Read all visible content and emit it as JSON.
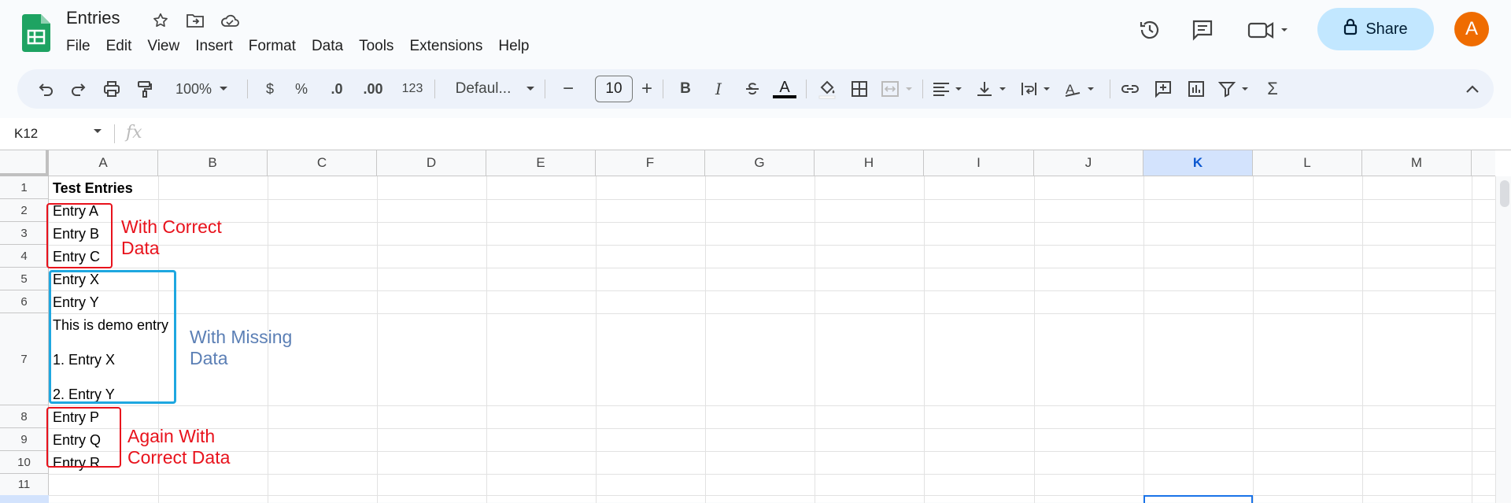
{
  "app": {
    "title": "Entries",
    "menu": [
      "File",
      "Edit",
      "View",
      "Insert",
      "Format",
      "Data",
      "Tools",
      "Extensions",
      "Help"
    ],
    "share_label": "Share",
    "avatar_letter": "A",
    "accent": "#0b57d0",
    "share_bg": "#c2e7ff",
    "avatar_bg": "#ef6c00"
  },
  "toolbar": {
    "zoom": "100%",
    "currency": "$",
    "percent": "%",
    "dec_decrease": ".0",
    "dec_increase": ".00",
    "number_format": "123",
    "font": "Defaul...",
    "font_size": "10",
    "minus": "−",
    "plus": "+",
    "bold": "B",
    "italic": "I",
    "text_color": "A",
    "sum": "Σ"
  },
  "formula_bar": {
    "cell_ref": "K12",
    "fx": "fx"
  },
  "grid": {
    "columns": [
      "A",
      "B",
      "C",
      "D",
      "E",
      "F",
      "G",
      "H",
      "I",
      "J",
      "K",
      "L",
      "M"
    ],
    "selected_column": "K",
    "rows": [
      "1",
      "2",
      "3",
      "4",
      "5",
      "6",
      "7",
      "8",
      "9",
      "10",
      "11"
    ],
    "cells": {
      "r1": "Test Entries",
      "r2": "Entry A",
      "r3": "Entry B",
      "r4": "Entry C",
      "r5": "Entry X",
      "r6": "Entry Y",
      "r7_line1": "This is demo entry",
      "r7_line2": "1. Entry X",
      "r7_line3": "2. Entry Y",
      "r8": "Entry P",
      "r9": "Entry Q",
      "r10": "Entry R"
    }
  },
  "annotations": {
    "correct_1_line1": "With Correct",
    "correct_1_line2": "Data",
    "missing_line1": "With Missing",
    "missing_line2": "Data",
    "correct_2_line1": "Again With",
    "correct_2_line2": "Correct Data",
    "red": "#e8121c",
    "blue": "#1ea7e0",
    "blue_text": "#5b7fb5"
  }
}
